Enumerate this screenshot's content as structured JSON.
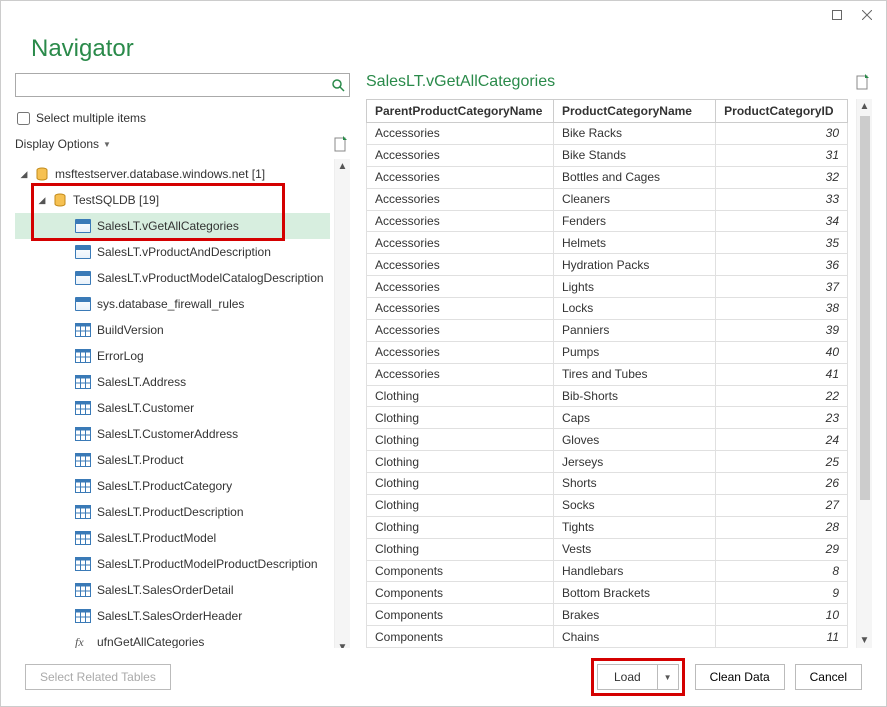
{
  "window": {
    "title": "Navigator"
  },
  "search": {
    "placeholder": ""
  },
  "select_multiple_label": "Select multiple items",
  "display_options_label": "Display Options",
  "tree": {
    "server": {
      "label": "msftestserver.database.windows.net [1]"
    },
    "database": {
      "label": "TestSQLDB [19]"
    },
    "items": [
      {
        "label": "SalesLT.vGetAllCategories",
        "type": "view",
        "selected": true
      },
      {
        "label": "SalesLT.vProductAndDescription",
        "type": "view"
      },
      {
        "label": "SalesLT.vProductModelCatalogDescription",
        "type": "view"
      },
      {
        "label": "sys.database_firewall_rules",
        "type": "view"
      },
      {
        "label": "BuildVersion",
        "type": "table"
      },
      {
        "label": "ErrorLog",
        "type": "table"
      },
      {
        "label": "SalesLT.Address",
        "type": "table"
      },
      {
        "label": "SalesLT.Customer",
        "type": "table"
      },
      {
        "label": "SalesLT.CustomerAddress",
        "type": "table"
      },
      {
        "label": "SalesLT.Product",
        "type": "table"
      },
      {
        "label": "SalesLT.ProductCategory",
        "type": "table"
      },
      {
        "label": "SalesLT.ProductDescription",
        "type": "table"
      },
      {
        "label": "SalesLT.ProductModel",
        "type": "table"
      },
      {
        "label": "SalesLT.ProductModelProductDescription",
        "type": "table"
      },
      {
        "label": "SalesLT.SalesOrderDetail",
        "type": "table"
      },
      {
        "label": "SalesLT.SalesOrderHeader",
        "type": "table"
      },
      {
        "label": "ufnGetAllCategories",
        "type": "fx"
      }
    ]
  },
  "preview": {
    "title": "SalesLT.vGetAllCategories",
    "columns": [
      "ParentProductCategoryName",
      "ProductCategoryName",
      "ProductCategoryID"
    ],
    "rows": [
      [
        "Accessories",
        "Bike Racks",
        "30"
      ],
      [
        "Accessories",
        "Bike Stands",
        "31"
      ],
      [
        "Accessories",
        "Bottles and Cages",
        "32"
      ],
      [
        "Accessories",
        "Cleaners",
        "33"
      ],
      [
        "Accessories",
        "Fenders",
        "34"
      ],
      [
        "Accessories",
        "Helmets",
        "35"
      ],
      [
        "Accessories",
        "Hydration Packs",
        "36"
      ],
      [
        "Accessories",
        "Lights",
        "37"
      ],
      [
        "Accessories",
        "Locks",
        "38"
      ],
      [
        "Accessories",
        "Panniers",
        "39"
      ],
      [
        "Accessories",
        "Pumps",
        "40"
      ],
      [
        "Accessories",
        "Tires and Tubes",
        "41"
      ],
      [
        "Clothing",
        "Bib-Shorts",
        "22"
      ],
      [
        "Clothing",
        "Caps",
        "23"
      ],
      [
        "Clothing",
        "Gloves",
        "24"
      ],
      [
        "Clothing",
        "Jerseys",
        "25"
      ],
      [
        "Clothing",
        "Shorts",
        "26"
      ],
      [
        "Clothing",
        "Socks",
        "27"
      ],
      [
        "Clothing",
        "Tights",
        "28"
      ],
      [
        "Clothing",
        "Vests",
        "29"
      ],
      [
        "Components",
        "Handlebars",
        "8"
      ],
      [
        "Components",
        "Bottom Brackets",
        "9"
      ],
      [
        "Components",
        "Brakes",
        "10"
      ],
      [
        "Components",
        "Chains",
        "11"
      ]
    ]
  },
  "footer": {
    "select_related": "Select Related Tables",
    "load": "Load",
    "clean": "Clean Data",
    "cancel": "Cancel"
  }
}
